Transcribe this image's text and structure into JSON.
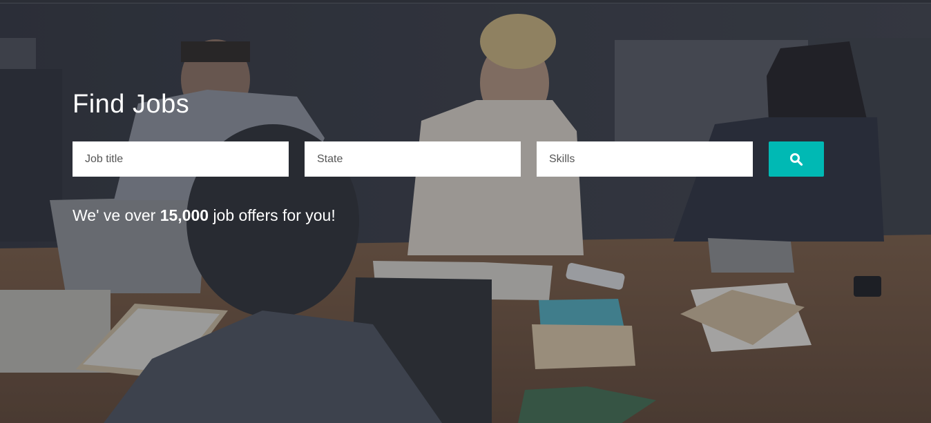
{
  "hero": {
    "title": "Find Jobs",
    "offers": {
      "prefix": "We' ve over",
      "count": "15,000",
      "suffix": "job offers for you!"
    }
  },
  "search": {
    "job_title_placeholder": "Job title",
    "state_placeholder": "State",
    "skills_placeholder": "Skills",
    "button_icon": "search-icon"
  },
  "colors": {
    "accent": "#00b9b4",
    "text": "#ffffff",
    "field_background": "#ffffff"
  }
}
